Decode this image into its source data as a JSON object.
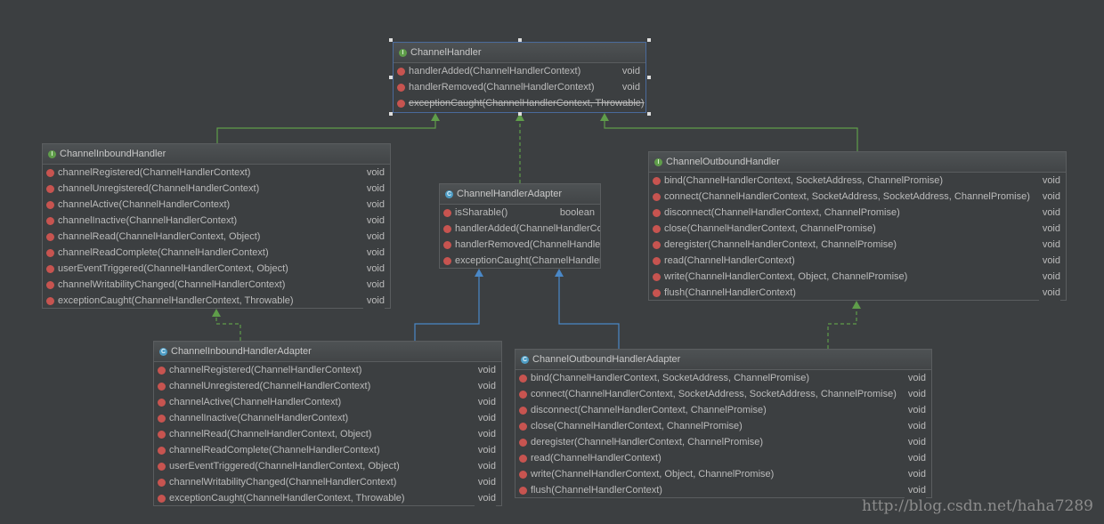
{
  "diagram": {
    "nodes": {
      "channelHandler": {
        "name": "ChannelHandler",
        "kind": "interface",
        "kind_icon": "interface-icon",
        "selected": true,
        "members": [
          {
            "sig": "handlerAdded(ChannelHandlerContext)",
            "ret": "void",
            "abstract": true,
            "deprecated": false
          },
          {
            "sig": "handlerRemoved(ChannelHandlerContext)",
            "ret": "void",
            "abstract": true,
            "deprecated": false
          },
          {
            "sig": "exceptionCaught(ChannelHandlerContext, Throwable)",
            "ret": "",
            "abstract": true,
            "deprecated": true
          }
        ]
      },
      "channelInboundHandler": {
        "name": "ChannelInboundHandler",
        "kind": "interface",
        "kind_icon": "interface-icon",
        "members": [
          {
            "sig": "channelRegistered(ChannelHandlerContext)",
            "ret": "void",
            "abstract": true
          },
          {
            "sig": "channelUnregistered(ChannelHandlerContext)",
            "ret": "void",
            "abstract": true
          },
          {
            "sig": "channelActive(ChannelHandlerContext)",
            "ret": "void",
            "abstract": true
          },
          {
            "sig": "channelInactive(ChannelHandlerContext)",
            "ret": "void",
            "abstract": true
          },
          {
            "sig": "channelRead(ChannelHandlerContext, Object)",
            "ret": "void",
            "abstract": true
          },
          {
            "sig": "channelReadComplete(ChannelHandlerContext)",
            "ret": "void",
            "abstract": true
          },
          {
            "sig": "userEventTriggered(ChannelHandlerContext, Object)",
            "ret": "void",
            "abstract": true
          },
          {
            "sig": "channelWritabilityChanged(ChannelHandlerContext)",
            "ret": "void",
            "abstract": true
          },
          {
            "sig": "exceptionCaught(ChannelHandlerContext, Throwable)",
            "ret": "void",
            "abstract": true
          }
        ]
      },
      "channelHandlerAdapter": {
        "name": "ChannelHandlerAdapter",
        "kind": "abstract-class",
        "kind_icon": "class-icon",
        "members": [
          {
            "sig": "isSharable()",
            "ret": "boolean",
            "abstract": false
          },
          {
            "sig": "handlerAdded(ChannelHandlerCo",
            "ret": "",
            "abstract": false
          },
          {
            "sig": "handlerRemoved(ChannelHandler",
            "ret": "",
            "abstract": false
          },
          {
            "sig": "exceptionCaught(ChannelHandler",
            "ret": "",
            "abstract": false
          }
        ]
      },
      "channelOutboundHandler": {
        "name": "ChannelOutboundHandler",
        "kind": "interface",
        "kind_icon": "interface-icon",
        "members": [
          {
            "sig": "bind(ChannelHandlerContext, SocketAddress, ChannelPromise)",
            "ret": "void",
            "abstract": true
          },
          {
            "sig": "connect(ChannelHandlerContext, SocketAddress, SocketAddress, ChannelPromise)",
            "ret": "void",
            "abstract": true
          },
          {
            "sig": "disconnect(ChannelHandlerContext, ChannelPromise)",
            "ret": "void",
            "abstract": true
          },
          {
            "sig": "close(ChannelHandlerContext, ChannelPromise)",
            "ret": "void",
            "abstract": true
          },
          {
            "sig": "deregister(ChannelHandlerContext, ChannelPromise)",
            "ret": "void",
            "abstract": true
          },
          {
            "sig": "read(ChannelHandlerContext)",
            "ret": "void",
            "abstract": true
          },
          {
            "sig": "write(ChannelHandlerContext, Object, ChannelPromise)",
            "ret": "void",
            "abstract": true
          },
          {
            "sig": "flush(ChannelHandlerContext)",
            "ret": "void",
            "abstract": true
          }
        ]
      },
      "channelInboundHandlerAdapter": {
        "name": "ChannelInboundHandlerAdapter",
        "kind": "class",
        "kind_icon": "class-icon",
        "members": [
          {
            "sig": "channelRegistered(ChannelHandlerContext)",
            "ret": "void",
            "abstract": false
          },
          {
            "sig": "channelUnregistered(ChannelHandlerContext)",
            "ret": "void",
            "abstract": false
          },
          {
            "sig": "channelActive(ChannelHandlerContext)",
            "ret": "void",
            "abstract": false
          },
          {
            "sig": "channelInactive(ChannelHandlerContext)",
            "ret": "void",
            "abstract": false
          },
          {
            "sig": "channelRead(ChannelHandlerContext, Object)",
            "ret": "void",
            "abstract": false
          },
          {
            "sig": "channelReadComplete(ChannelHandlerContext)",
            "ret": "void",
            "abstract": false
          },
          {
            "sig": "userEventTriggered(ChannelHandlerContext, Object)",
            "ret": "void",
            "abstract": false
          },
          {
            "sig": "channelWritabilityChanged(ChannelHandlerContext)",
            "ret": "void",
            "abstract": false
          },
          {
            "sig": "exceptionCaught(ChannelHandlerContext, Throwable)",
            "ret": "void",
            "abstract": false
          }
        ]
      },
      "channelOutboundHandlerAdapter": {
        "name": "ChannelOutboundHandlerAdapter",
        "kind": "class",
        "kind_icon": "class-icon",
        "members": [
          {
            "sig": "bind(ChannelHandlerContext, SocketAddress, ChannelPromise)",
            "ret": "void",
            "abstract": false
          },
          {
            "sig": "connect(ChannelHandlerContext, SocketAddress, SocketAddress, ChannelPromise)",
            "ret": "void",
            "abstract": false
          },
          {
            "sig": "disconnect(ChannelHandlerContext, ChannelPromise)",
            "ret": "void",
            "abstract": false
          },
          {
            "sig": "close(ChannelHandlerContext, ChannelPromise)",
            "ret": "void",
            "abstract": false
          },
          {
            "sig": "deregister(ChannelHandlerContext, ChannelPromise)",
            "ret": "void",
            "abstract": false
          },
          {
            "sig": "read(ChannelHandlerContext)",
            "ret": "void",
            "abstract": false
          },
          {
            "sig": "write(ChannelHandlerContext, Object, ChannelPromise)",
            "ret": "void",
            "abstract": false
          },
          {
            "sig": "flush(ChannelHandlerContext)",
            "ret": "void",
            "abstract": false
          }
        ]
      }
    },
    "edges": [
      {
        "from": "channelInboundHandler",
        "to": "channelHandler",
        "type": "extends-interface",
        "style": "solid",
        "color": "#5f9d4a"
      },
      {
        "from": "channelOutboundHandler",
        "to": "channelHandler",
        "type": "extends-interface",
        "style": "solid",
        "color": "#5f9d4a"
      },
      {
        "from": "channelHandlerAdapter",
        "to": "channelHandler",
        "type": "implements",
        "style": "dashed",
        "color": "#5f9d4a"
      },
      {
        "from": "channelInboundHandlerAdapter",
        "to": "channelInboundHandler",
        "type": "implements",
        "style": "dashed",
        "color": "#5f9d4a"
      },
      {
        "from": "channelOutboundHandlerAdapter",
        "to": "channelOutboundHandler",
        "type": "implements",
        "style": "dashed",
        "color": "#5f9d4a"
      },
      {
        "from": "channelInboundHandlerAdapter",
        "to": "channelHandlerAdapter",
        "type": "extends",
        "style": "solid",
        "color": "#4a88c7"
      },
      {
        "from": "channelOutboundHandlerAdapter",
        "to": "channelHandlerAdapter",
        "type": "extends",
        "style": "solid",
        "color": "#4a88c7"
      }
    ]
  },
  "colors": {
    "background": "#3c3f41",
    "interface_edge": "#5f9d4a",
    "class_edge": "#4a88c7",
    "method_icon": "#c75450",
    "interface_icon": "#5f9d4a",
    "class_icon": "#4d9cc4"
  },
  "watermark": "http://blog.csdn.net/haha7289"
}
